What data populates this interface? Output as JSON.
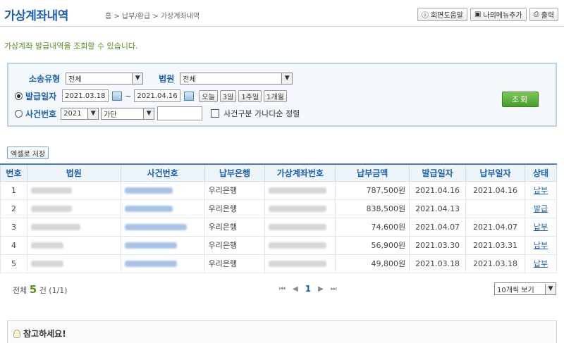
{
  "header": {
    "title": "가상계좌내역",
    "breadcrumb": "홈 > 납부/환급 > 가상계좌내역",
    "help_label": "회면도움말",
    "mymenu_label": "나의메뉴추가",
    "print_label": "출력"
  },
  "intro": "가상계좌 발급내역을 조회할 수 있습니다.",
  "search": {
    "send_type_label": "소송유형",
    "send_type_value": "전체",
    "court_label": "법원",
    "court_value": "전체",
    "issue_date_label": "발급일자",
    "date_from": "2021.03.18",
    "date_to": "2021.04.16",
    "tilde": "~",
    "quick": [
      "오늘",
      "3일",
      "1주일",
      "1개월"
    ],
    "case_no_label": "사건번호",
    "case_year": "2021",
    "case_type": "가단",
    "case_number": "",
    "sort_label": "사건구분 가나다순 정렬",
    "search_button": "조회"
  },
  "excel_button": "엑셀로 저장",
  "table": {
    "headers": [
      "번호",
      "법원",
      "사건번호",
      "납부은행",
      "가상계좌번호",
      "납부금액",
      "발급일자",
      "납부일자",
      "상태"
    ],
    "rows": [
      {
        "no": "1",
        "bank": "우리은행",
        "amount": "787,500원",
        "issue": "2021.04.16",
        "paid": "2021.04.16",
        "state": "납부"
      },
      {
        "no": "2",
        "bank": "우리은행",
        "amount": "838,500원",
        "issue": "2021.04.13",
        "paid": "",
        "state": "발급"
      },
      {
        "no": "3",
        "bank": "우리은행",
        "amount": "74,600원",
        "issue": "2021.04.07",
        "paid": "2021.04.07",
        "state": "납부"
      },
      {
        "no": "4",
        "bank": "우리은행",
        "amount": "56,900원",
        "issue": "2021.03.30",
        "paid": "2021.03.31",
        "state": "납부"
      },
      {
        "no": "5",
        "bank": "우리은행",
        "amount": "49,800원",
        "issue": "2021.03.18",
        "paid": "2021.03.18",
        "state": "납부"
      }
    ]
  },
  "footer": {
    "total_prefix": "전체",
    "total_count": "5",
    "total_suffix": "건 (1/1)",
    "first": "⏮",
    "prev": "◀",
    "page": "1",
    "next": "▶",
    "last": "⏭",
    "page_size": "10개씩 보기"
  },
  "notice_title": "참고하세요!"
}
